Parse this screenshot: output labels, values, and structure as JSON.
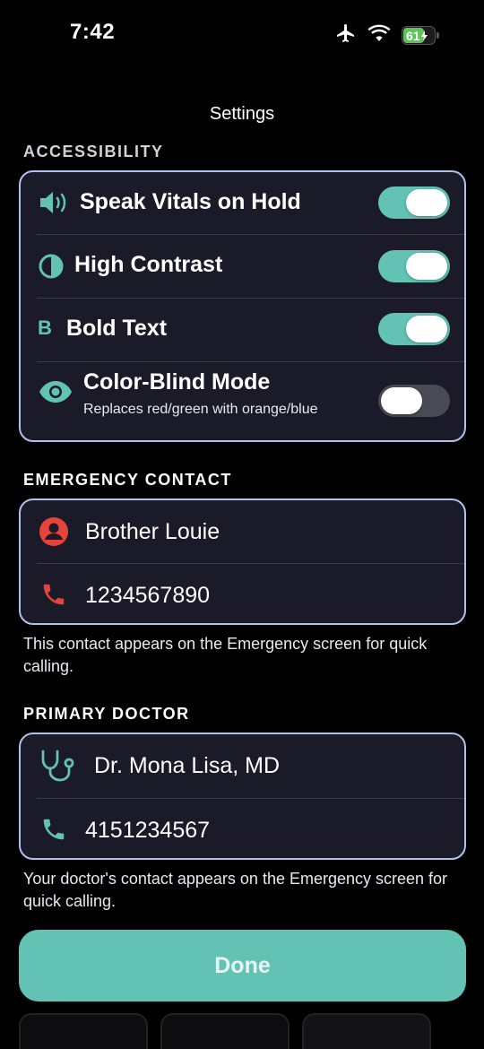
{
  "status_bar": {
    "time": "7:42",
    "battery_level": "61",
    "icons": [
      "airplane-icon",
      "wifi-icon",
      "battery-charging-icon"
    ]
  },
  "nav": {
    "title": "Settings"
  },
  "accessibility": {
    "header": "ACCESSIBILITY",
    "items": [
      {
        "label": "Speak Vitals on Hold",
        "icon": "speaker-icon",
        "enabled": true
      },
      {
        "label": "High Contrast",
        "icon": "contrast-icon",
        "enabled": true
      },
      {
        "label": "Bold Text",
        "icon": "bold-icon",
        "icon_glyph": "B",
        "enabled": true
      },
      {
        "label": "Color-Blind Mode",
        "sublabel": "Replaces red/green with orange/blue",
        "icon": "eye-icon",
        "enabled": false
      }
    ]
  },
  "emergency_contact": {
    "header": "EMERGENCY CONTACT",
    "name": "Brother Louie",
    "phone": "1234567890",
    "footnote": "This contact appears on the Emergency screen for quick calling."
  },
  "primary_doctor": {
    "header": "PRIMARY DOCTOR",
    "name": "Dr. Mona Lisa, MD",
    "phone": "4151234567",
    "footnote": "Your doctor's contact appears on the Emergency screen for quick calling."
  },
  "done_button": {
    "label": "Done"
  },
  "colors": {
    "accent": "#62c3b5",
    "danger": "#e5443a",
    "card_border": "#b3c0ec",
    "card_bg": "#1b1a28"
  }
}
